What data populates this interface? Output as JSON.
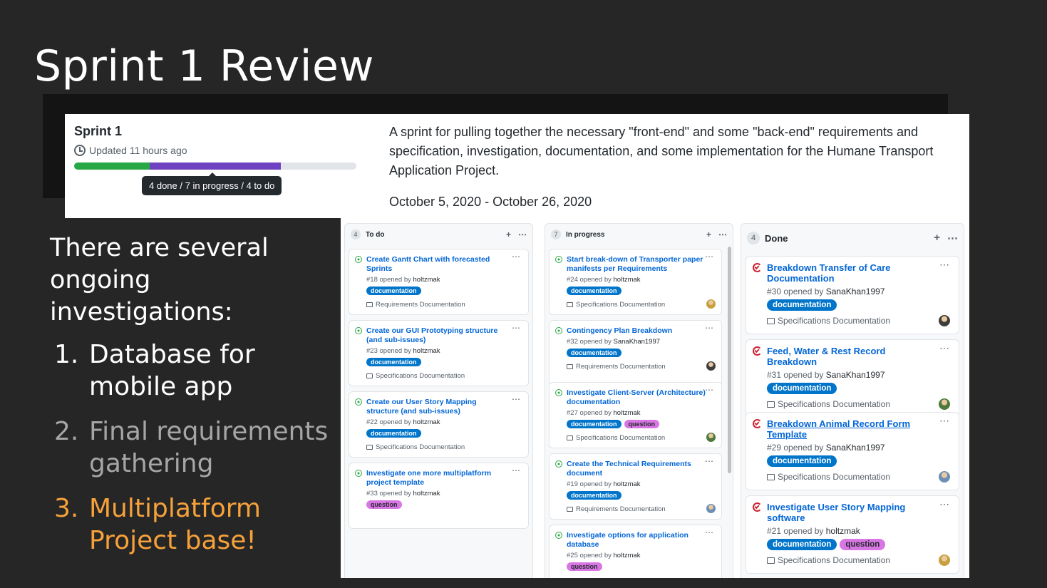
{
  "slide": {
    "title": "Sprint 1 Review",
    "notes_intro": "There are several ongoing investigations:",
    "items": [
      {
        "num": "1.",
        "text": "Database for mobile app",
        "color": "#ffffff"
      },
      {
        "num": "2.",
        "text": "Final requirements gathering",
        "color": "#a6a6a6"
      },
      {
        "num": "3.",
        "text": "Multiplatform Project base!",
        "color": "#f7a13a"
      }
    ]
  },
  "milestone": {
    "title": "Sprint 1",
    "updated": "Updated 11 hours ago",
    "progress_tooltip": "4 done / 7 in progress / 4 to do",
    "progress": {
      "done": 4,
      "in_progress": 7,
      "todo": 4
    },
    "colors": {
      "done": "#28a745",
      "in_progress": "#6f42c1",
      "todo": "#e1e4e8"
    },
    "description": "A sprint for pulling together the necessary \"front-end\" and some \"back-end\" requirements and specification, investigation, documentation, and some implementation for the Humane Transport Application Project.",
    "dates": "October 5, 2020 - October 26, 2020"
  },
  "board": {
    "columns": [
      {
        "name": "To do",
        "count": "4",
        "cards": [
          {
            "state": "open",
            "title": "Create Gantt Chart with forecasted Sprints",
            "number": "#18",
            "opened_by": "opened by",
            "author": "holtzmak",
            "labels": [
              "documentation"
            ],
            "project": "Requirements Documentation",
            "avatar": false
          },
          {
            "state": "open",
            "title": "Create our GUI Prototyping structure (and sub-issues)",
            "number": "#23",
            "opened_by": "opened by",
            "author": "holtzmak",
            "labels": [
              "documentation"
            ],
            "project": "Specifications Documentation",
            "avatar": false
          },
          {
            "state": "open",
            "title": "Create our User Story Mapping structure (and sub-issues)",
            "number": "#22",
            "opened_by": "opened by",
            "author": "holtzmak",
            "labels": [
              "documentation"
            ],
            "project": "Specifications Documentation",
            "avatar": false
          },
          {
            "state": "open",
            "title": "Investigate one more multiplatform project template",
            "number": "#33",
            "opened_by": "opened by",
            "author": "holtzmak",
            "labels": [
              "question"
            ],
            "project": "",
            "avatar": false
          }
        ]
      },
      {
        "name": "In progress",
        "count": "7",
        "cards": [
          {
            "state": "open",
            "title": "Start break-down of Transporter paper manifests per Requirements",
            "number": "#24",
            "opened_by": "opened by",
            "author": "holtzmak",
            "labels": [
              "documentation"
            ],
            "project": "Specifications Documentation",
            "avatar": true
          },
          {
            "state": "open",
            "title": "Contingency Plan Breakdown",
            "number": "#32",
            "opened_by": "opened by",
            "author": "SanaKhan1997",
            "labels": [
              "documentation"
            ],
            "project": "Requirements Documentation",
            "avatar": true
          },
          {
            "state": "open",
            "title": "Investigate Client-Server (Architecture) documentation",
            "number": "#27",
            "opened_by": "opened by",
            "author": "holtzmak",
            "labels": [
              "documentation",
              "question"
            ],
            "project": "Specifications Documentation",
            "avatar": true
          },
          {
            "state": "open",
            "title": "Create the Technical Requirements document",
            "number": "#19",
            "opened_by": "opened by",
            "author": "holtzmak",
            "labels": [
              "documentation"
            ],
            "project": "Requirements Documentation",
            "avatar": true
          },
          {
            "state": "open",
            "title": "Investigate options for application database",
            "number": "#25",
            "opened_by": "opened by",
            "author": "holtzmak",
            "labels": [
              "question"
            ],
            "project": "",
            "avatar": false
          }
        ]
      },
      {
        "name": "Done",
        "count": "4",
        "cards": [
          {
            "state": "closed",
            "title": "Breakdown Transfer of Care Documentation",
            "number": "#30",
            "opened_by": "opened by",
            "author": "SanaKhan1997",
            "labels": [
              "documentation"
            ],
            "project": "Specifications Documentation",
            "avatar": true
          },
          {
            "state": "closed",
            "title": "Feed, Water & Rest Record Breakdown",
            "number": "#31",
            "opened_by": "opened by",
            "author": "SanaKhan1997",
            "labels": [
              "documentation"
            ],
            "project": "Specifications Documentation",
            "avatar": true
          },
          {
            "state": "closed",
            "title": "Breakdown Animal Record Form Template",
            "number": "#29",
            "opened_by": "opened by",
            "author": "SanaKhan1997",
            "labels": [
              "documentation"
            ],
            "project": "Specifications Documentation",
            "avatar": true,
            "underline": true
          },
          {
            "state": "closed",
            "title": "Investigate User Story Mapping software",
            "number": "#21",
            "opened_by": "opened by",
            "author": "holtzmak",
            "labels": [
              "documentation",
              "question"
            ],
            "project": "Specifications Documentation",
            "avatar": true
          }
        ]
      }
    ]
  }
}
